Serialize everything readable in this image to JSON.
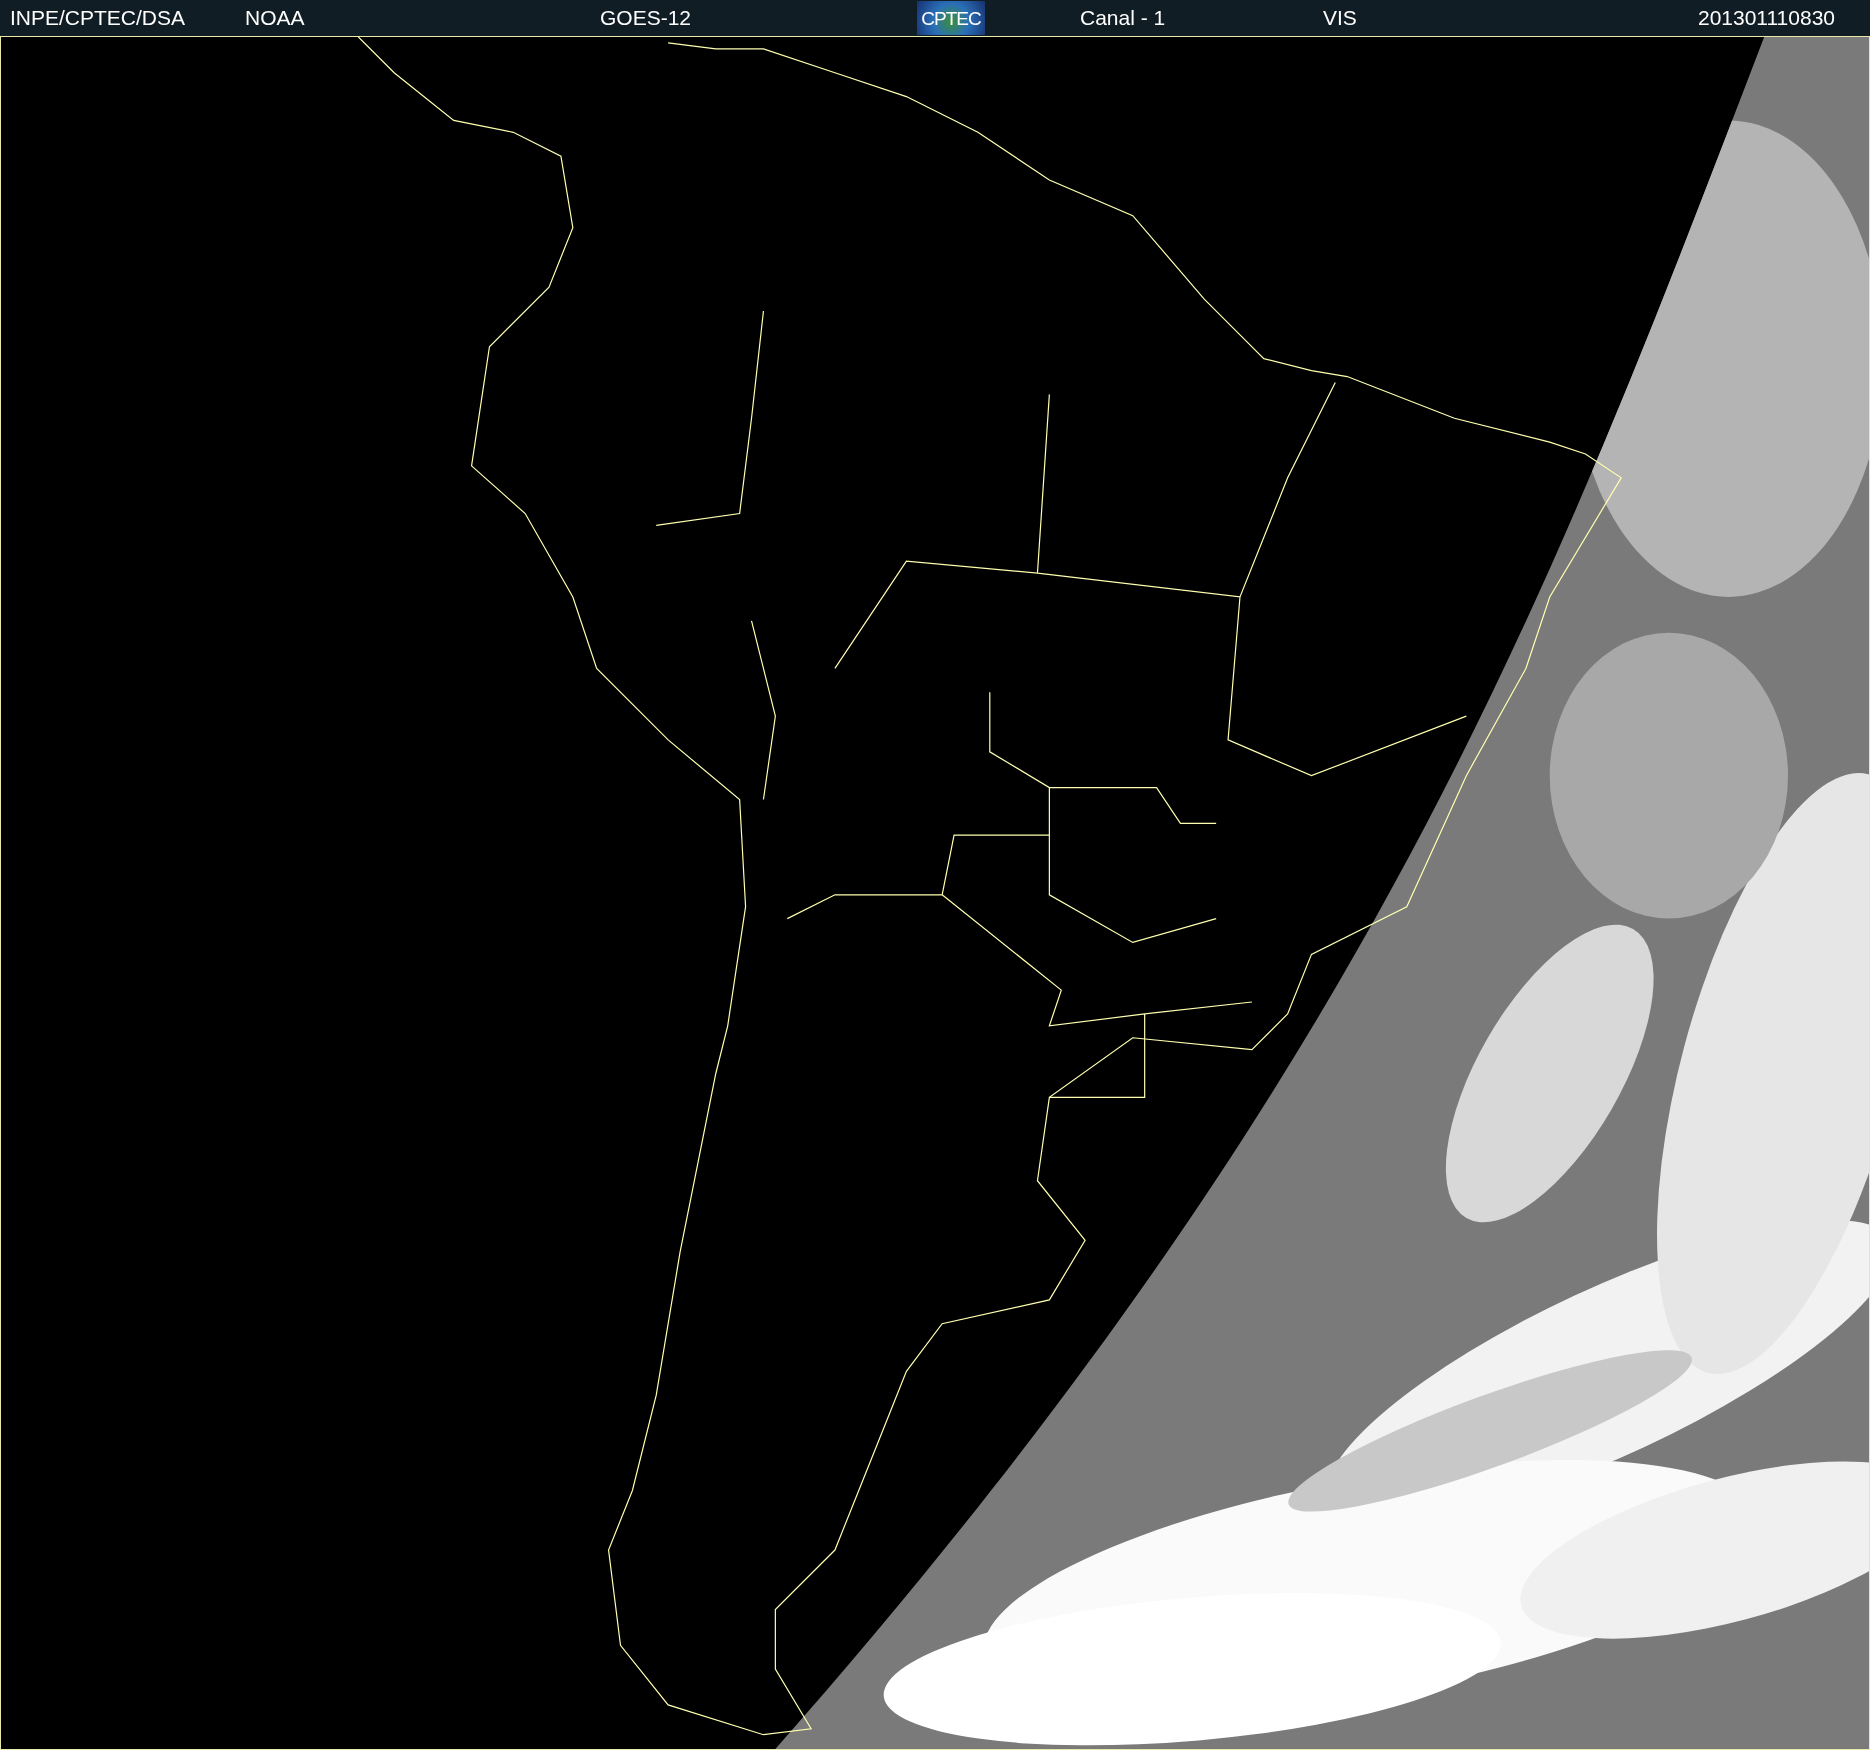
{
  "header": {
    "items": [
      {
        "kind": "text",
        "text": "INPE/CPTEC/DSA"
      },
      {
        "kind": "text",
        "text": "NOAA"
      },
      {
        "kind": "text",
        "text": "GOES-12"
      },
      {
        "kind": "logo",
        "text": "CPTEC"
      },
      {
        "kind": "text",
        "text": "Canal - 1"
      },
      {
        "kind": "text",
        "text": "VIS"
      },
      {
        "kind": "text",
        "text": "201301110830"
      }
    ]
  }
}
